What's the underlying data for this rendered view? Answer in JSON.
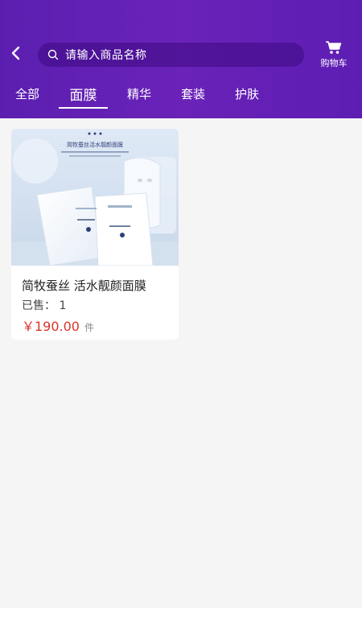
{
  "header": {
    "search_placeholder": "请输入商品名称",
    "cart_label": "购物车",
    "accent_color": "#6a22b8"
  },
  "tabs": [
    {
      "label": "全部"
    },
    {
      "label": "面膜"
    },
    {
      "label": "精华"
    },
    {
      "label": "套装"
    },
    {
      "label": "护肤"
    }
  ],
  "active_tab": "面膜",
  "products": [
    {
      "image_caption": "简牧蚕丝活水靓颜面膜",
      "title": "简牧蚕丝 活水靓颜面膜",
      "sold_label": "已售：",
      "sold_count": "1",
      "price": "￥190.00",
      "unit": "件"
    }
  ],
  "icons": {
    "back": "chevron-left-icon",
    "search": "search-icon",
    "cart": "cart-icon"
  },
  "colors": {
    "price": "#d9342b",
    "background": "#f5f5f5"
  }
}
